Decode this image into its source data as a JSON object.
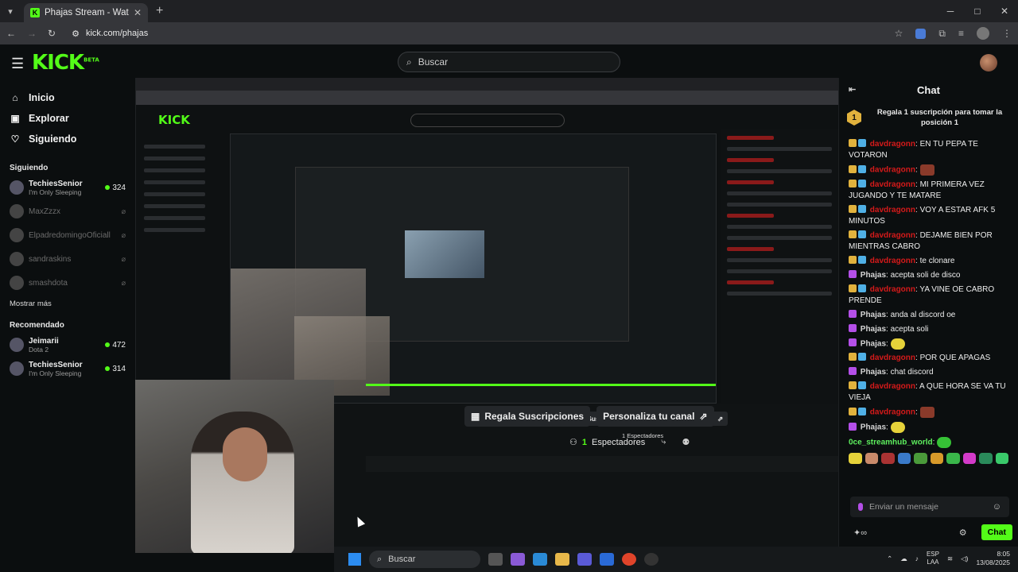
{
  "browser": {
    "tab_title": "Phajas Stream - Watch Live on K",
    "url": "kick.com/phajas",
    "new_tab": "+",
    "min": "─",
    "max": "□",
    "close": "✕"
  },
  "header": {
    "logo": "KICK",
    "logo_tag": "BETA",
    "search_placeholder": "Buscar"
  },
  "sidebar": {
    "nav": [
      {
        "label": "Inicio",
        "icon": "home-icon"
      },
      {
        "label": "Explorar",
        "icon": "compass-icon"
      },
      {
        "label": "Siguiendo",
        "icon": "heart-icon"
      }
    ],
    "following_title": "Siguiendo",
    "following": [
      {
        "name": "TechiesSenior",
        "sub": "I'm Only Sleeping",
        "viewers": "324",
        "live": true
      },
      {
        "name": "MaxZzzx",
        "live": false
      },
      {
        "name": "ElpadredomingoOficiall",
        "live": false
      },
      {
        "name": "sandraskins",
        "live": false
      },
      {
        "name": "smashdota",
        "live": false
      }
    ],
    "show_more": "Mostrar más",
    "recommended_title": "Recomendado",
    "recommended": [
      {
        "name": "Jeimarii",
        "sub": "Dota 2",
        "viewers": "472"
      },
      {
        "name": "TechiesSenior",
        "sub": "I'm Only Sleeping",
        "viewers": "314"
      }
    ]
  },
  "stream": {
    "gift_subs": "Regala Suscripciones",
    "customize": "Personaliza tu canal",
    "viewers_count": "1",
    "viewers_label": "Espectadores",
    "mid_viewers": "1 Espectadores"
  },
  "chat": {
    "title": "Chat",
    "pinned_rank": "1",
    "pinned_text": "Regala 1 suscripción para tomar la posición 1",
    "messages": [
      {
        "user": "davdragonn",
        "text": "EN TU PEPA TE VOTARON",
        "color": "red"
      },
      {
        "user": "davdragonn",
        "text": "",
        "color": "red",
        "emote": true
      },
      {
        "user": "davdragonn",
        "text": "MI PRIMERA VEZ JUGANDO Y TE MATARE",
        "color": "red"
      },
      {
        "user": "davdragonn",
        "text": "VOY A ESTAR AFK 5 MINUTOS",
        "color": "red"
      },
      {
        "user": "davdragonn",
        "text": "DEJAME BIEN POR MIENTRAS CABRO",
        "color": "red"
      },
      {
        "user": "davdragonn",
        "text": "te clonare",
        "color": "red"
      },
      {
        "user": "Phajas",
        "text": "acepta soli de disco",
        "color": "grey"
      },
      {
        "user": "davdragonn",
        "text": "YA VINE OE CABRO PRENDE",
        "color": "red"
      },
      {
        "user": "Phajas",
        "text": "anda al discord oe",
        "color": "grey"
      },
      {
        "user": "Phajas",
        "text": "acepta soli",
        "color": "grey"
      },
      {
        "user": "Phajas",
        "text": "",
        "color": "grey",
        "emote": true
      },
      {
        "user": "davdragonn",
        "text": "POR QUE APAGAS",
        "color": "red"
      },
      {
        "user": "Phajas",
        "text": "chat discord",
        "color": "grey"
      },
      {
        "user": "davdragonn",
        "text": "A QUE HORA SE VA TU VIEJA",
        "color": "red"
      },
      {
        "user": "davdragonn",
        "text": "",
        "color": "red",
        "emote": true
      },
      {
        "user": "Phajas",
        "text": "",
        "color": "grey",
        "emote": true
      },
      {
        "user": "0ce_streamhub_world",
        "text": "",
        "color": "green",
        "emote": true
      }
    ],
    "input_placeholder": "Enviar un mensaje",
    "send_label": "Chat",
    "accent": "#53fc18"
  },
  "taskbar": {
    "search_placeholder": "Buscar",
    "lang": "ESP",
    "lang_sub": "LAA",
    "time": "8:05",
    "date": "13/08/2025"
  }
}
